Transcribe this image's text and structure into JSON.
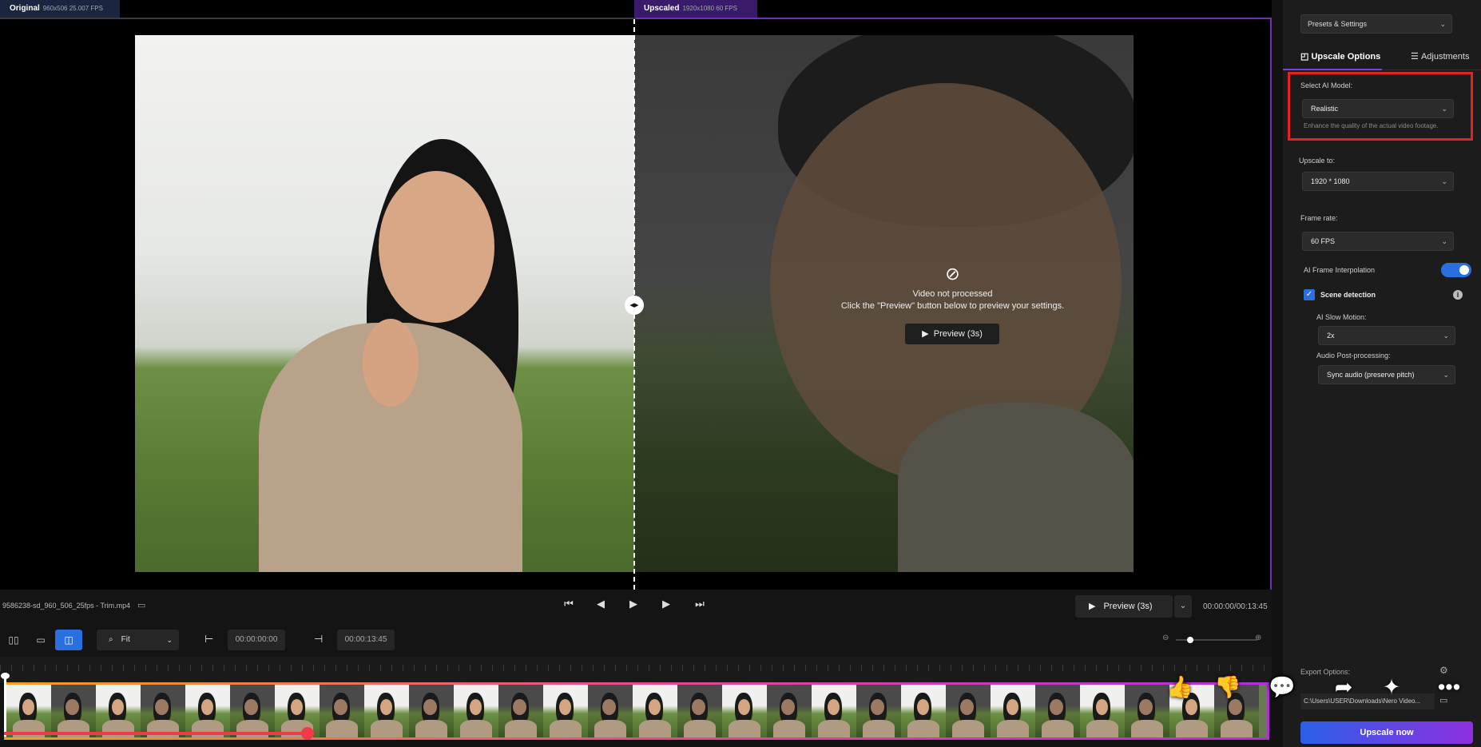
{
  "viewer": {
    "original_tab": {
      "label": "Original",
      "meta": "960x506 25.007 FPS"
    },
    "upscaled_tab": {
      "label": "Upscaled",
      "meta": "1920x1080 60 FPS"
    },
    "not_processed_title": "Video not processed",
    "not_processed_hint": "Click the \"Preview\" button below to preview your settings.",
    "overlay_preview_label": "Preview (3s)"
  },
  "controls": {
    "file_name": "9586238-sd_960_506_25fps - Trim.mp4",
    "preview_label": "Preview (3s)",
    "time_display": "00:00:00/00:13:45"
  },
  "timeline": {
    "zoom_value": "Fit",
    "start_time": "00:00:00:00",
    "end_time": "00:00:13:45",
    "playback_progress": 0.24
  },
  "panel": {
    "presets_label": "Presets & Settings",
    "tab_upscale": "Upscale Options",
    "tab_adjustments": "Adjustments",
    "ai_model_label": "Select AI Model:",
    "ai_model_value": "Realistic",
    "ai_model_hint": "Enhance the quality of the actual video footage.",
    "upscale_to_label": "Upscale to:",
    "upscale_to_value": "1920 * 1080",
    "frame_rate_label": "Frame rate:",
    "frame_rate_value": "60 FPS",
    "interp_label": "AI Frame Interpolation",
    "interp_on": true,
    "scene_label": "Scene detection",
    "scene_checked": true,
    "slow_motion_label": "AI Slow Motion:",
    "slow_motion_value": "2x",
    "audio_label": "Audio Post-processing:",
    "audio_value": "Sync audio (preserve pitch)",
    "export_label": "Export Options:",
    "export_path": "C:\\Users\\USER\\Downloads\\Nero Video...",
    "upscale_button": "Upscale now"
  },
  "colors": {
    "accent": "#2a6fe0",
    "purple": "#7b3fe4",
    "highlight_box": "#e52222",
    "progress": "#f03a4a"
  },
  "yt_icons": [
    "thumbs-up-icon",
    "thumbs-down-icon",
    "comment-icon",
    "share-icon",
    "sparkle-icon",
    "more-icon"
  ]
}
